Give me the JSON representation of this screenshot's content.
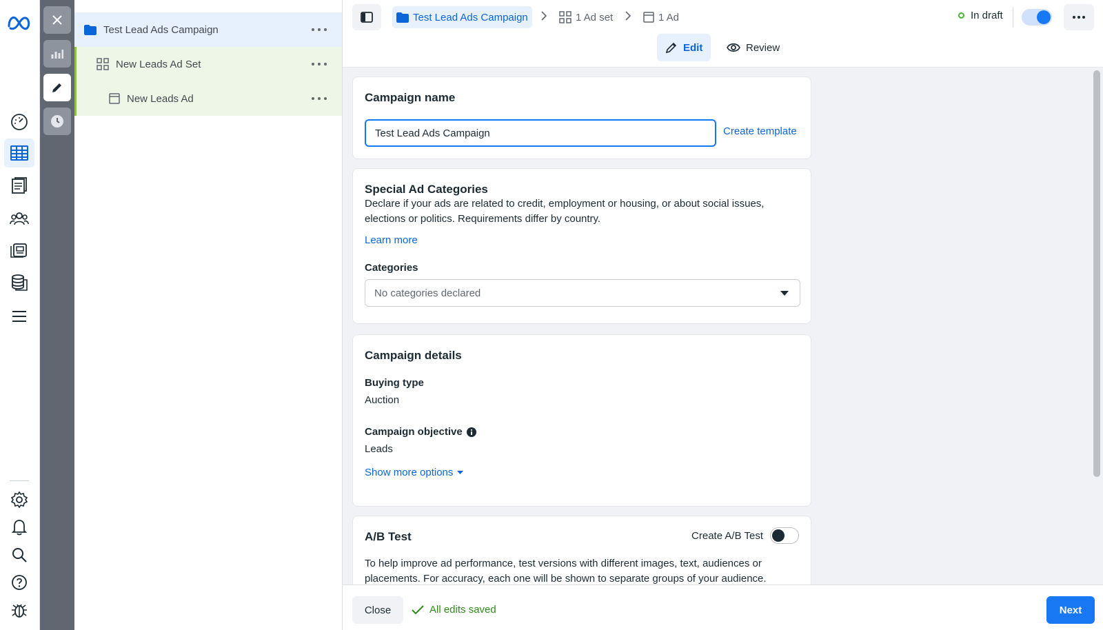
{
  "colors": {
    "accent": "#1877f2",
    "link": "#0a66d8",
    "success": "#2f8a1b",
    "tool_strip": "#606770"
  },
  "nav": {
    "icons": [
      "meta-logo",
      "dashboard-icon",
      "table-icon",
      "pages-icon",
      "audience-icon",
      "catalog-icon",
      "database-icon",
      "menu-icon",
      "settings-icon",
      "bell-icon",
      "search-icon",
      "help-icon",
      "bug-icon"
    ]
  },
  "tree": {
    "campaign": "Test Lead Ads Campaign",
    "adset": "New Leads Ad Set",
    "ad": "New Leads Ad"
  },
  "header": {
    "breadcrumb_campaign": "Test Lead Ads Campaign",
    "breadcrumb_adset": "1 Ad set",
    "breadcrumb_ad": "1 Ad",
    "status": "In draft",
    "toggle_on": true,
    "tab_edit": "Edit",
    "tab_review": "Review"
  },
  "campaign_name": {
    "title": "Campaign name",
    "value": "Test Lead Ads Campaign",
    "create_template": "Create template"
  },
  "special": {
    "title": "Special Ad Categories",
    "description": "Declare if your ads are related to credit, employment or housing, or about social issues, elections or politics. Requirements differ by country.",
    "learn_more": "Learn more",
    "categories_label": "Categories",
    "categories_value": "No categories declared"
  },
  "details": {
    "title": "Campaign details",
    "buying_type_label": "Buying type",
    "buying_type_value": "Auction",
    "objective_label": "Campaign objective",
    "objective_value": "Leads",
    "show_more": "Show more options"
  },
  "ab_test": {
    "title": "A/B Test",
    "toggle_label": "Create A/B Test",
    "toggle_on": false,
    "description": "To help improve ad performance, test versions with different images, text, audiences or placements. For accuracy, each one will be shown to separate groups of your audience."
  },
  "footer": {
    "close": "Close",
    "saved": "All edits saved",
    "next": "Next"
  }
}
